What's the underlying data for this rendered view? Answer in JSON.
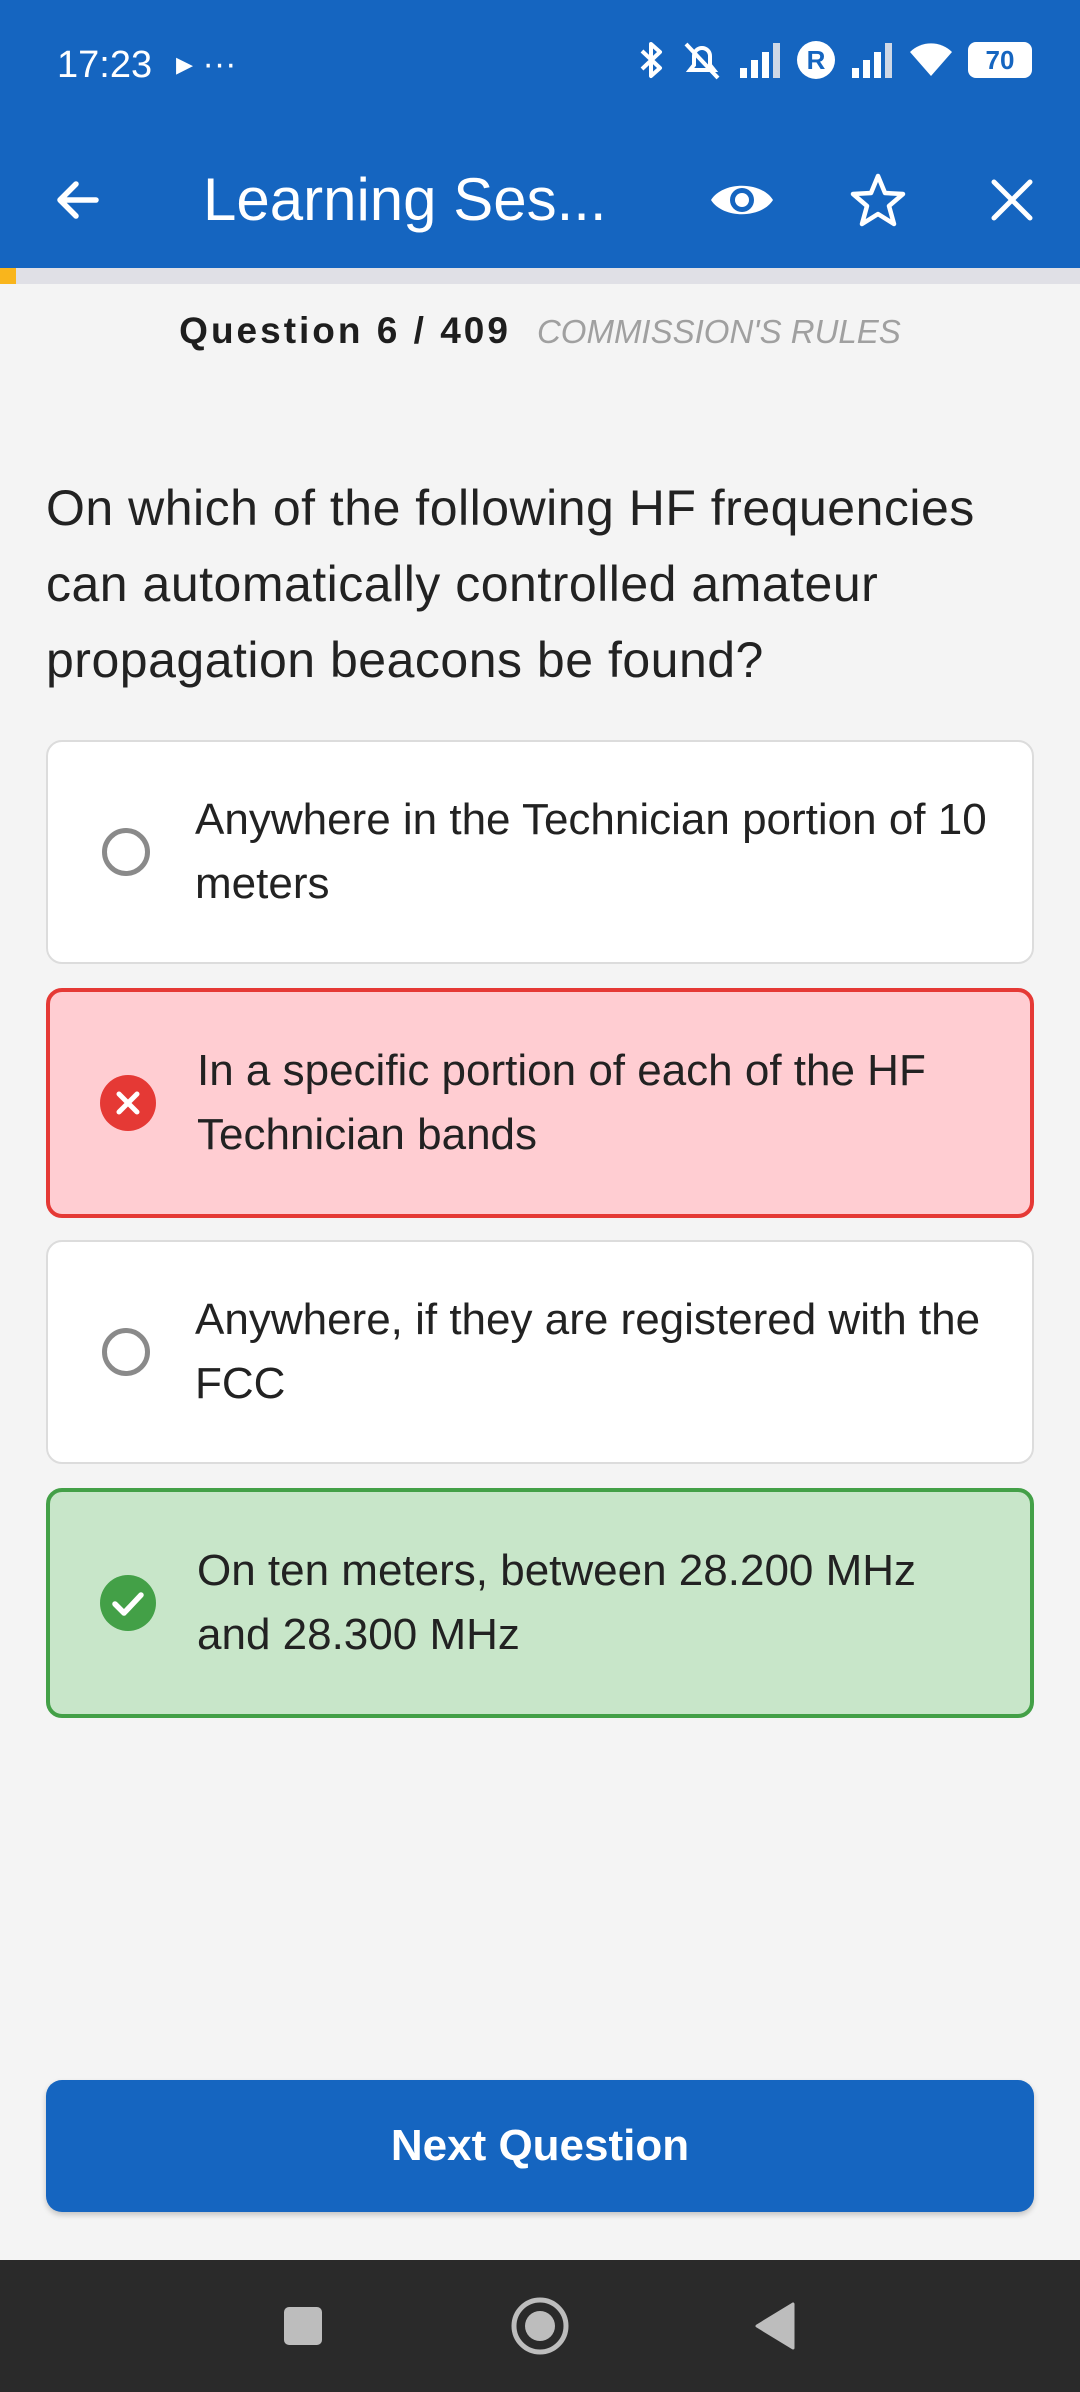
{
  "status_bar": {
    "time": "17:23",
    "left_icons": "▸ ···",
    "battery": "70"
  },
  "app_bar": {
    "title": "Learning Ses...",
    "back_icon": "arrow-left-icon",
    "view_icon": "eye-icon",
    "favorite_icon": "star-outline-icon",
    "close_icon": "close-icon"
  },
  "progress": {
    "fraction": 0.0147,
    "color": "#f9b51c"
  },
  "question": {
    "number_label": "Question 6 / 409",
    "category": "COMMISSION'S RULES",
    "text": "On which of the following HF frequencies can automatically controlled amateur propagation beacons be found?"
  },
  "options": [
    {
      "text": "Anywhere in the Technician portion of 10 meters",
      "state": "unselected"
    },
    {
      "text": "In a specific portion of each of the HF Technician bands",
      "state": "incorrect"
    },
    {
      "text": "Anywhere, if they are registered with the FCC",
      "state": "unselected"
    },
    {
      "text": "On ten meters, between 28.200 MHz and 28.300 MHz",
      "state": "correct"
    }
  ],
  "next_button": {
    "label": "Next Question"
  },
  "colors": {
    "primary": "#1565c0",
    "incorrect_bg": "#ffcdd2",
    "incorrect_border": "#e53935",
    "correct_bg": "#c8e6c9",
    "correct_border": "#43a047"
  }
}
